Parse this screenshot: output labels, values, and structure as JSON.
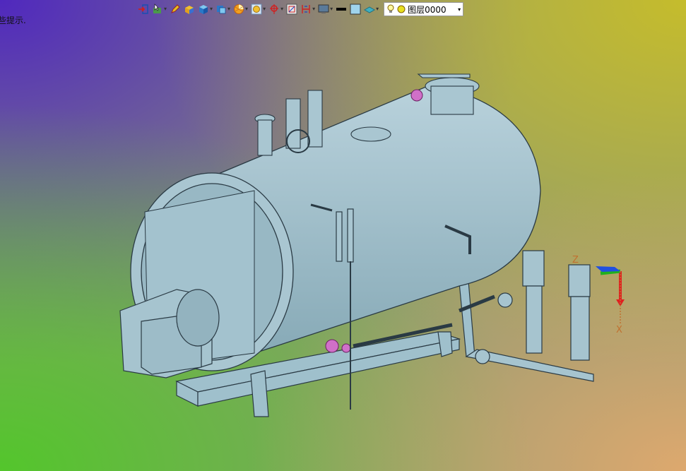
{
  "hint_text": "些提示.",
  "toolbar": {
    "buttons": [
      {
        "icon": "snap-icon",
        "has_dropdown": false
      },
      {
        "icon": "pointer-select-icon",
        "has_dropdown": true
      },
      {
        "icon": "pencil-icon",
        "has_dropdown": false
      },
      {
        "icon": "box-solid-icon",
        "has_dropdown": false
      },
      {
        "icon": "cube-icon",
        "has_dropdown": true
      },
      {
        "icon": "view-cube-icon",
        "has_dropdown": true
      },
      {
        "icon": "render-mode-icon",
        "has_dropdown": true
      },
      {
        "icon": "zoom-view-icon",
        "has_dropdown": true
      },
      {
        "icon": "point-icon",
        "has_dropdown": true
      },
      {
        "icon": "grid-icon",
        "has_dropdown": false
      },
      {
        "icon": "dimension-icon",
        "has_dropdown": true
      },
      {
        "icon": "monitor-icon",
        "has_dropdown": true
      },
      {
        "icon": "line-weight-icon",
        "has_dropdown": false
      },
      {
        "icon": "color-swatch-icon",
        "has_dropdown": false
      },
      {
        "icon": "layer-surface-icon",
        "has_dropdown": true
      }
    ],
    "layer": {
      "name": "图层0000",
      "bulb_icon": "lightbulb-icon",
      "color": "#e8e020"
    }
  },
  "axis_labels": {
    "z": "Z",
    "x": "X"
  },
  "colors": {
    "model": "#9fc0cc",
    "edge": "#2a3a44",
    "valve": "#d070c8",
    "axis_x": "#e02020",
    "axis_y": "#20b020",
    "axis_z": "#2050e0"
  }
}
